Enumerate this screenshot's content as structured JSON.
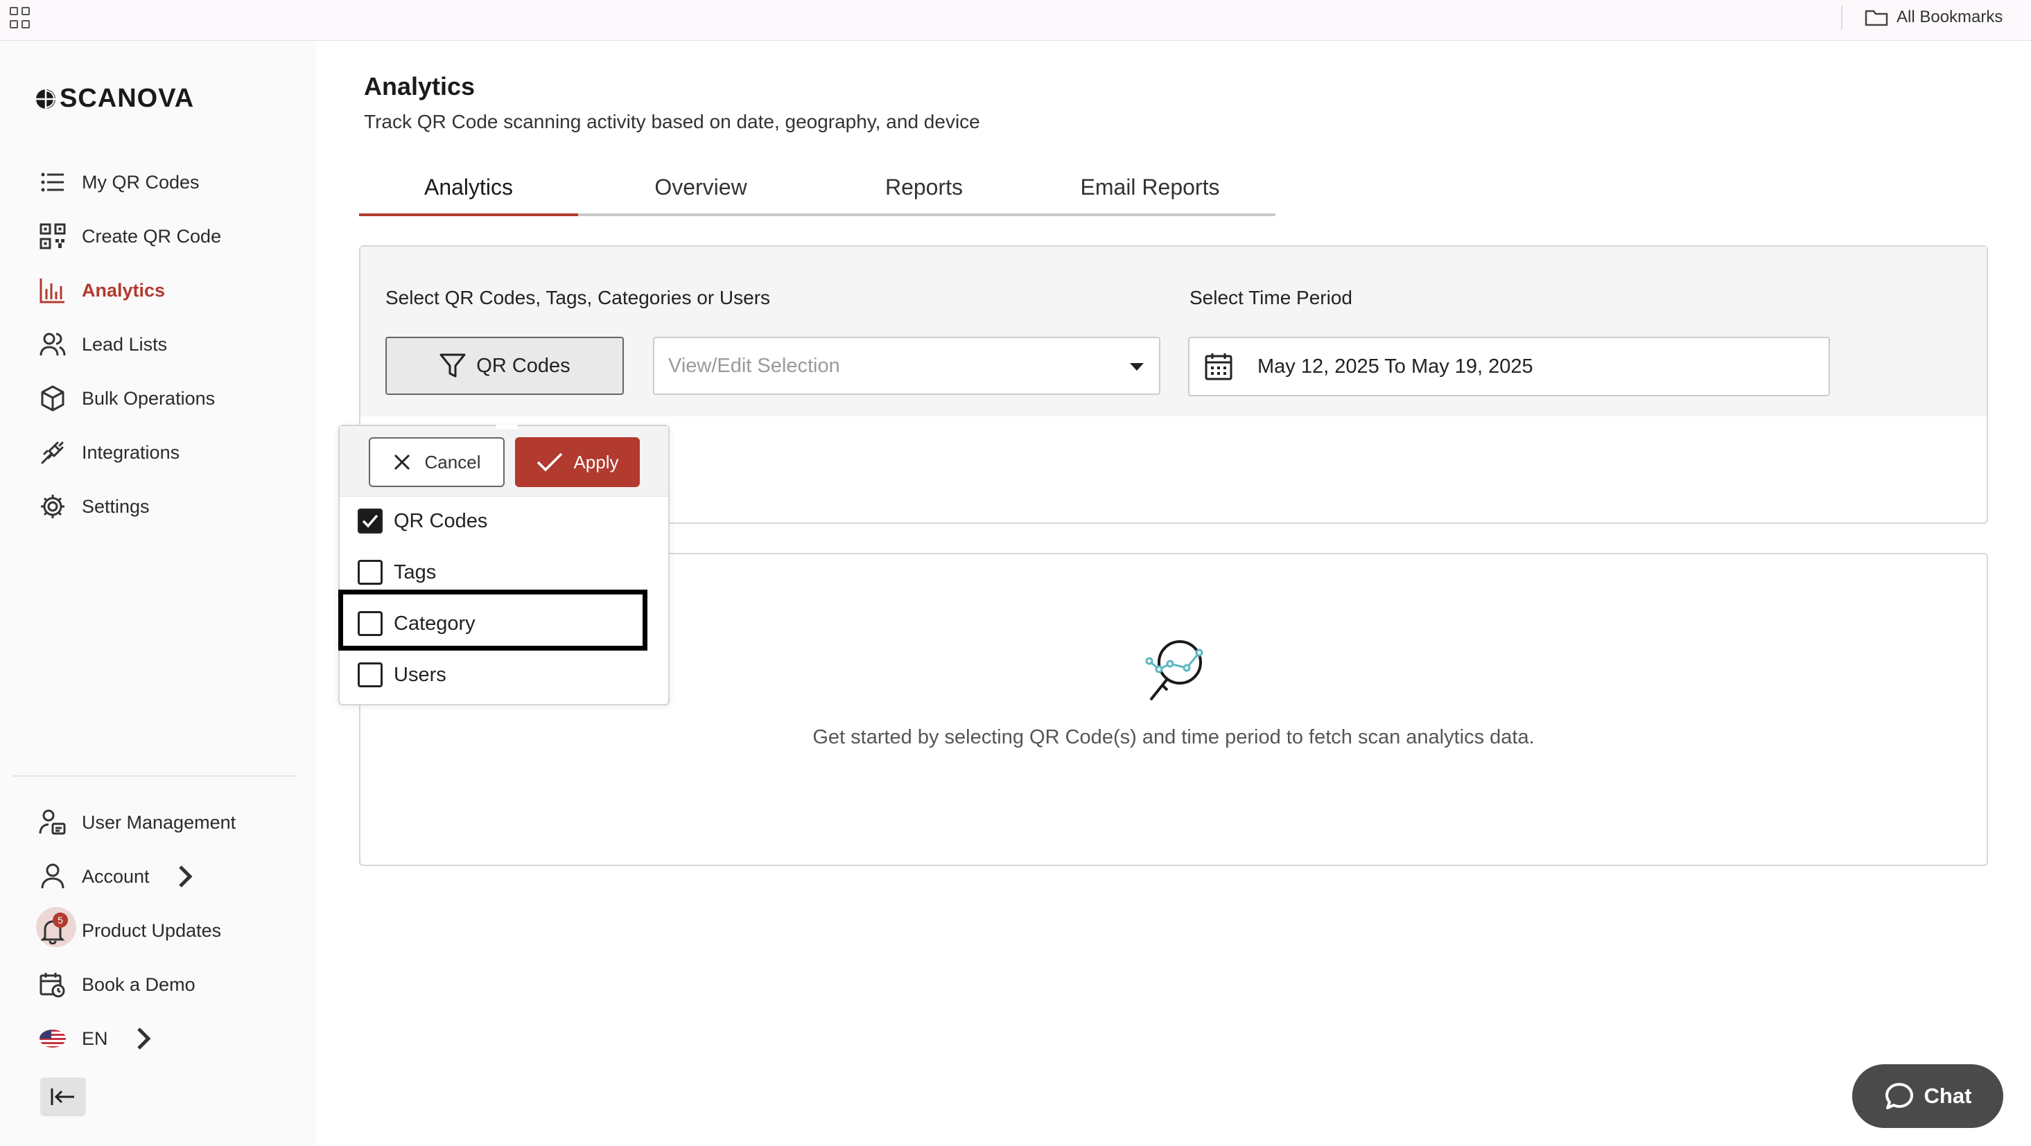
{
  "bookmarks_bar": {
    "all_bookmarks": "All Bookmarks"
  },
  "brand": {
    "name": "SCANOVA",
    "accent_color": "#b23a2e"
  },
  "sidebar": {
    "items": [
      {
        "label": "My QR Codes",
        "icon": "list-icon"
      },
      {
        "label": "Create QR Code",
        "icon": "qr-code-icon"
      },
      {
        "label": "Analytics",
        "icon": "bar-chart-icon",
        "active": true
      },
      {
        "label": "Lead Lists",
        "icon": "users-icon"
      },
      {
        "label": "Bulk Operations",
        "icon": "box-icon"
      },
      {
        "label": "Integrations",
        "icon": "plug-icon"
      },
      {
        "label": "Settings",
        "icon": "gear-icon"
      }
    ],
    "bottom_items": [
      {
        "label": "User Management",
        "icon": "user-card-icon"
      },
      {
        "label": "Account",
        "icon": "user-icon"
      },
      {
        "label": "Product Updates",
        "icon": "bell-icon",
        "badge": "5"
      },
      {
        "label": "Book a Demo",
        "icon": "calendar-clock-icon"
      },
      {
        "label": "EN",
        "icon": "us-flag-icon"
      }
    ]
  },
  "page": {
    "title": "Analytics",
    "subtitle": "Track QR Code scanning activity based on date, geography, and device"
  },
  "tabs": [
    {
      "label": "Analytics",
      "active": true
    },
    {
      "label": "Overview"
    },
    {
      "label": "Reports"
    },
    {
      "label": "Email Reports"
    }
  ],
  "filters": {
    "select_label": "Select QR Codes, Tags, Categories or Users",
    "time_label": "Select Time Period",
    "type_button": "QR Codes",
    "selection_placeholder": "View/Edit Selection",
    "date_range": "May 12, 2025 To May 19, 2025"
  },
  "dropdown": {
    "cancel": "Cancel",
    "apply": "Apply",
    "options": [
      {
        "label": "QR Codes",
        "checked": true
      },
      {
        "label": "Tags",
        "checked": false
      },
      {
        "label": "Category",
        "checked": false
      },
      {
        "label": "Users",
        "checked": false
      }
    ]
  },
  "empty_state": {
    "message": "Get started by selecting QR Code(s) and time period to fetch scan analytics data."
  },
  "chat": {
    "label": "Chat"
  }
}
